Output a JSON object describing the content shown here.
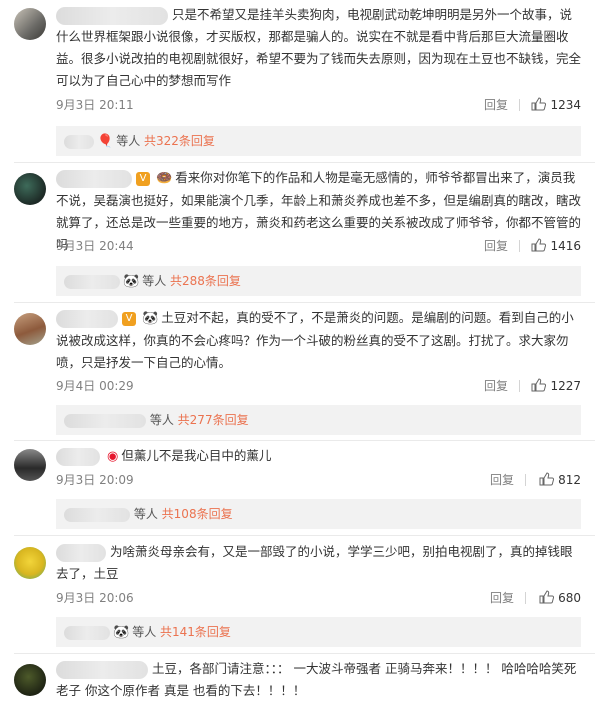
{
  "comments": [
    {
      "text": "只是不希望又是挂羊头卖狗肉，电视剧武动乾坤明明是另外一个故事，说什么世界框架跟小说很像，才买版权，那都是骗人的。说实在不就是看中背后那巨大流量圈收益。很多小说改拍的电视剧就很好，希望不要为了钱而失去原则，因为现在土豆也不缺钱，完全可以为了自己心中的梦想而写作",
      "time": "9月3日 20:11",
      "reply": "回复",
      "likes": "1234",
      "sub_suffix": "等人",
      "sub_link": "共322条回复"
    },
    {
      "text": "看来你对你笔下的作品和人物是毫无感情的，师爷爷都冒出来了，演员我不说，吴磊演也挺好，如果能演个几季，年龄上和萧炎养成也差不多，但是编剧真的瞎改，瞎改就算了，还总是改一些重要的地方，萧炎和药老这么重要的关系被改成了师爷爷，你都不管管的吗",
      "time": "9月3日 20:44",
      "reply": "回复",
      "likes": "1416",
      "sub_suffix": "等人",
      "sub_link": "共288条回复"
    },
    {
      "text": "土豆对不起，真的受不了，不是萧炎的问题。是编剧的问题。看到自己的小说被改成这样，你真的不会心疼吗？作为一个斗破的粉丝真的受不了这剧。打扰了。求大家勿喷，只是抒发一下自己的心情。",
      "time": "9月4日 00:29",
      "reply": "回复",
      "likes": "1227",
      "sub_suffix": "等人",
      "sub_link": "共277条回复"
    },
    {
      "text": "但薰儿不是我心目中的薰儿",
      "time": "9月3日 20:09",
      "reply": "回复",
      "likes": "812",
      "sub_suffix": "等人",
      "sub_link": "共108条回复"
    },
    {
      "text": "为啥萧炎母亲会有，又是一部毁了的小说，学学三少吧，别拍电视剧了，真的掉钱眼去了，土豆",
      "time": "9月3日 20:06",
      "reply": "回复",
      "likes": "680",
      "sub_suffix": "等人",
      "sub_link": "共141条回复"
    },
    {
      "text": "土豆，各部门请注意：：：  一大波斗帝强者 正骑马奔来！！！！  哈哈哈哈笑死老子 你这个原作者 真是 也看的下去！！！！"
    }
  ],
  "colors": {
    "link": "#eb7350",
    "meta": "#808080",
    "sub_bg": "#f2f2f2"
  }
}
